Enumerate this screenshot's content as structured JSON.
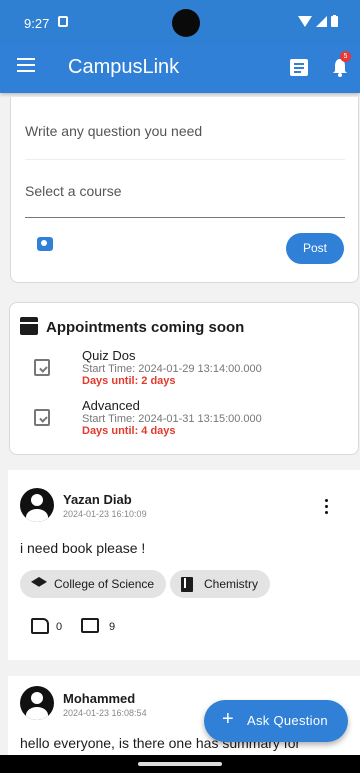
{
  "status": {
    "time": "9:27"
  },
  "header": {
    "title": "CampusLink",
    "notification_badge": "5"
  },
  "composer": {
    "question_placeholder": "Write any question you need",
    "course_placeholder": "Select a course",
    "post_label": "Post"
  },
  "appointments": {
    "heading": "Appointments coming soon",
    "items": [
      {
        "name": "Quiz Dos",
        "start": "Start Time: 2024-01-29 13:14:00.000",
        "days": "Days until: 2 days"
      },
      {
        "name": "Advanced",
        "start": "Start Time: 2024-01-31 13:15:00.000",
        "days": "Days until: 4 days"
      }
    ]
  },
  "posts": [
    {
      "user": "Yazan Diab",
      "date": "2024-01-23 16:10:09",
      "text": "i need book please !",
      "college": "College of Science",
      "subject": "Chemistry",
      "likes": "0",
      "comments": "9"
    },
    {
      "user": "Mohammed",
      "date": "2024-01-23 16:08:54",
      "text": "hello everyone, is there one has summary for"
    }
  ],
  "fab": {
    "label": "Ask Question",
    "icon": "plus-icon"
  },
  "colors": {
    "primary": "#2f80d6",
    "danger": "#e03b2e"
  }
}
